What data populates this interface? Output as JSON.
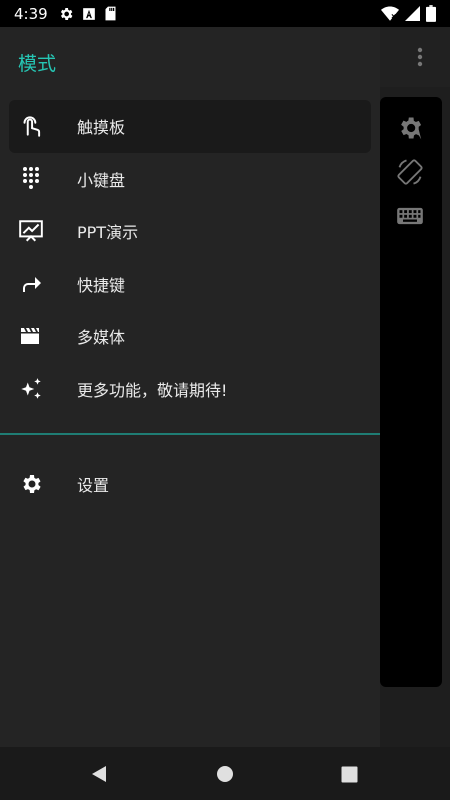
{
  "statusbar": {
    "time": "4:39",
    "left_icons": [
      "gear-icon",
      "font-icon",
      "sd-card-icon"
    ],
    "right_icons": [
      "wifi-icon",
      "signal-icon",
      "battery-icon"
    ]
  },
  "drawer": {
    "title": "模式",
    "items": [
      {
        "label": "触摸板",
        "icon": "touchpad-icon",
        "active": true
      },
      {
        "label": "小键盘",
        "icon": "dialpad-icon",
        "active": false
      },
      {
        "label": "PPT演示",
        "icon": "presentation-icon",
        "active": false
      },
      {
        "label": "快捷键",
        "icon": "shortcut-arrow-icon",
        "active": false
      },
      {
        "label": "多媒体",
        "icon": "clapperboard-icon",
        "active": false
      },
      {
        "label": "更多功能，敬请期待!",
        "icon": "sparkle-icon",
        "active": false
      }
    ],
    "settings_label": "设置"
  },
  "colors": {
    "accent": "#26c6b4",
    "drawer_bg": "#242424",
    "divider": "#1f7d74"
  }
}
